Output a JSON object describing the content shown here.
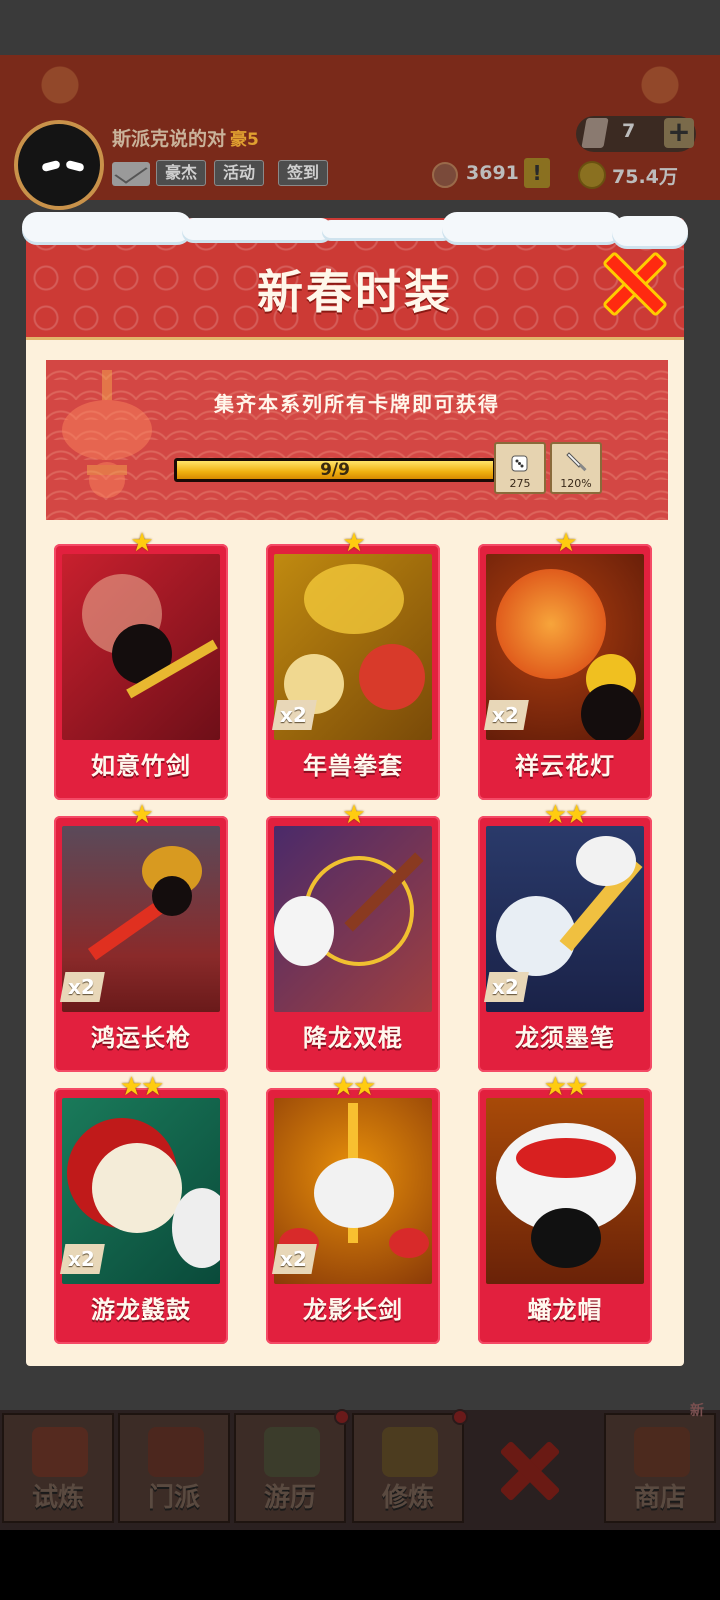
{
  "background_ui": {
    "player_name": "斯派克说的对",
    "player_rank": "豪5",
    "tags": [
      "豪杰",
      "活动",
      "签到"
    ],
    "gems": "7",
    "tokens": "3691",
    "coins": "75.4万",
    "nav_tabs": [
      "试炼",
      "门派",
      "游历",
      "修炼",
      "商店"
    ],
    "new_badge": "新"
  },
  "modal": {
    "title": "新春时装",
    "banner_text": "集齐本系列所有卡牌即可获得",
    "progress": {
      "label": "9/9",
      "current": 9,
      "total": 9
    },
    "rewards": [
      {
        "icon": "dice-icon",
        "value": "275"
      },
      {
        "icon": "sword-icon",
        "value": "120%"
      }
    ]
  },
  "cards": [
    {
      "name": "如意竹剑",
      "stars": "★",
      "mult": ""
    },
    {
      "name": "年兽拳套",
      "stars": "★",
      "mult": "x2"
    },
    {
      "name": "祥云花灯",
      "stars": "★",
      "mult": "x2"
    },
    {
      "name": "鸿运长枪",
      "stars": "★",
      "mult": "x2"
    },
    {
      "name": "降龙双棍",
      "stars": "★",
      "mult": ""
    },
    {
      "name": "龙须墨笔",
      "stars": "★★",
      "mult": "x2"
    },
    {
      "name": "游龙鼗鼓",
      "stars": "★★",
      "mult": "x2"
    },
    {
      "name": "龙影长剑",
      "stars": "★★",
      "mult": "x2"
    },
    {
      "name": "蟠龙帽",
      "stars": "★★",
      "mult": ""
    }
  ],
  "colors": {
    "header_red": "#cc3a35",
    "card_red": "#e2203e",
    "panel_cream": "#fdf1dc",
    "progress_gold": "#f0b010",
    "star_gold": "#ffcc10"
  }
}
